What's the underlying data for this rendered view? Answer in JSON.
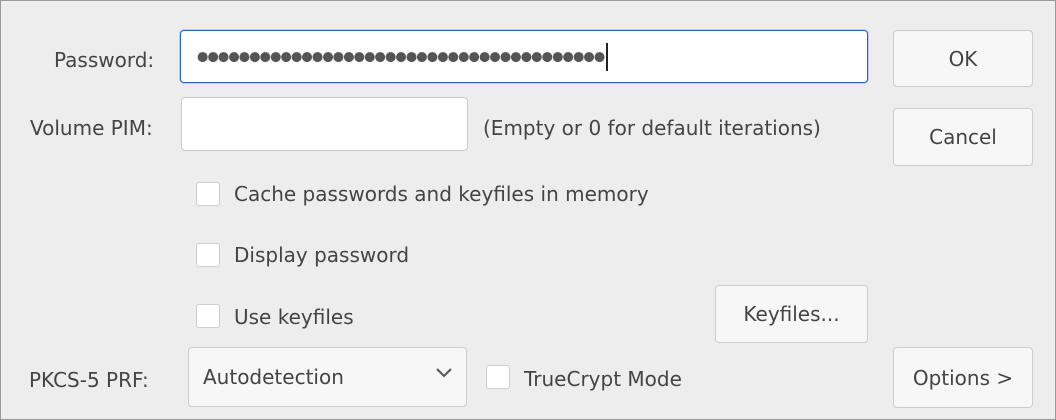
{
  "password": {
    "label": "Password:",
    "masked_value": "●●●●●●●●●●●●●●●●●●●●●●●●●●●●●●●●●●●●●●●"
  },
  "pim": {
    "label": "Volume PIM:",
    "value": "",
    "hint": "(Empty or 0 for default iterations)"
  },
  "options": {
    "cache": {
      "label": "Cache passwords and keyfiles in memory",
      "checked": false
    },
    "display_password": {
      "label": "Display password",
      "checked": false
    },
    "use_keyfiles": {
      "label": "Use keyfiles",
      "checked": false
    },
    "truecrypt_mode": {
      "label": "TrueCrypt Mode",
      "checked": false
    }
  },
  "prf": {
    "label": "PKCS-5 PRF:",
    "selected": "Autodetection"
  },
  "buttons": {
    "ok": "OK",
    "cancel": "Cancel",
    "keyfiles": "Keyfiles...",
    "options": "Options >"
  },
  "colors": {
    "dialog_bg": "#ededed",
    "focus_border": "#2a62b8"
  }
}
